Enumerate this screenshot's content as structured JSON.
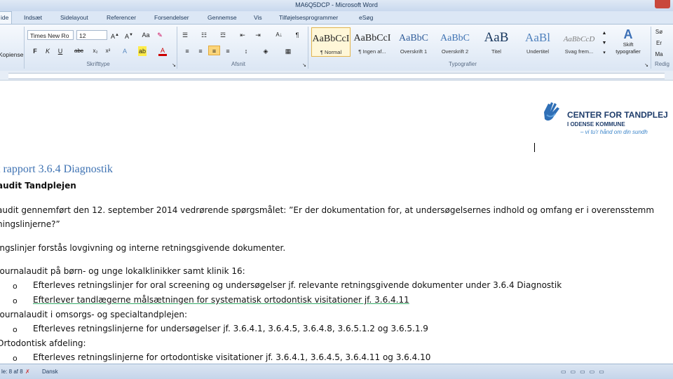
{
  "window": {
    "title": "MA6Q5DCP  -  Microsoft Word"
  },
  "tabs": [
    "ide",
    "Indsæt",
    "Sidelayout",
    "Referencer",
    "Forsendelser",
    "Gennemse",
    "Vis",
    "Tilføjelsesprogrammer",
    "eSøg"
  ],
  "ribbon": {
    "clipboard_label": "Kopiensel",
    "font_name": "Times New Ro",
    "font_size": "12",
    "group_font": "Skrifttype",
    "group_paragraph": "Afsnit",
    "group_styles": "Typografier",
    "group_edit": "Redig",
    "change_styles_1": "Skift",
    "change_styles_2": "typografier",
    "styles": [
      {
        "preview": "AaBbCcI",
        "name": "¶ Normal"
      },
      {
        "preview": "AaBbCcI",
        "name": "¶ Ingen af..."
      },
      {
        "preview": "AaBbC",
        "name": "Overskrift 1"
      },
      {
        "preview": "AaBbC",
        "name": "Overskrift 2"
      },
      {
        "preview": "AaB",
        "name": "Titel"
      },
      {
        "preview": "AaBl",
        "name": "Undertitel"
      },
      {
        "preview": "AaBbCcD",
        "name": "Svag frem..."
      }
    ]
  },
  "logo": {
    "name": "CENTER FOR TANDPLEJ",
    "sub": "I ODENSE KOMMUNE",
    "tag": "– vi tu'r hånd om din sundh"
  },
  "document": {
    "heading": "t rapport 3.6.4 Diagnostik",
    "subheading": "audit Tandplejen",
    "p1_line1": "audit gennemført den 12. september 2014 vedrørende spørgsmålet: ”Er der dokumentation for, at undersøgelsernes indhold og omfang er i overensstemm",
    "p1_line2": "ningslinjerne?”",
    "p2": "ingslinjer forstås lovgivning og interne retningsgivende dokumenter.",
    "sec1": "Journalaudit på børn- og unge lokalklinikker samt klinik 16:",
    "sec1_items": [
      "Efterleves retningslinjer for oral screening og undersøgelser   jf. relevante retningsgivende dokumenter under 3.6.4 Diagnostik",
      "Efterlever tandlægerne målsætningen for systematisk ortodontisk visitationer  jf. 3.6.4.11"
    ],
    "sec2": "Journalaudit i omsorgs- og specialtandplejen:",
    "sec2_items": [
      "Efterleves retningslinjerne for undersøgelser jf. 3.6.4.1, 3.6.4.5, 3.6.4.8, 3.6.5.1.2 og 3.6.5.1.9"
    ],
    "sec3": "Ortodontisk afdeling:",
    "sec3_items": [
      "Efterleves retningslinjerne for ortodontiske visitationer  jf. 3.6.4.1, 3.6.4.5, 3.6.4.11 og 3.6.4.10"
    ],
    "bullet_char": "o"
  },
  "status": {
    "pages": "le: 8 af 8",
    "language": "Dansk"
  }
}
